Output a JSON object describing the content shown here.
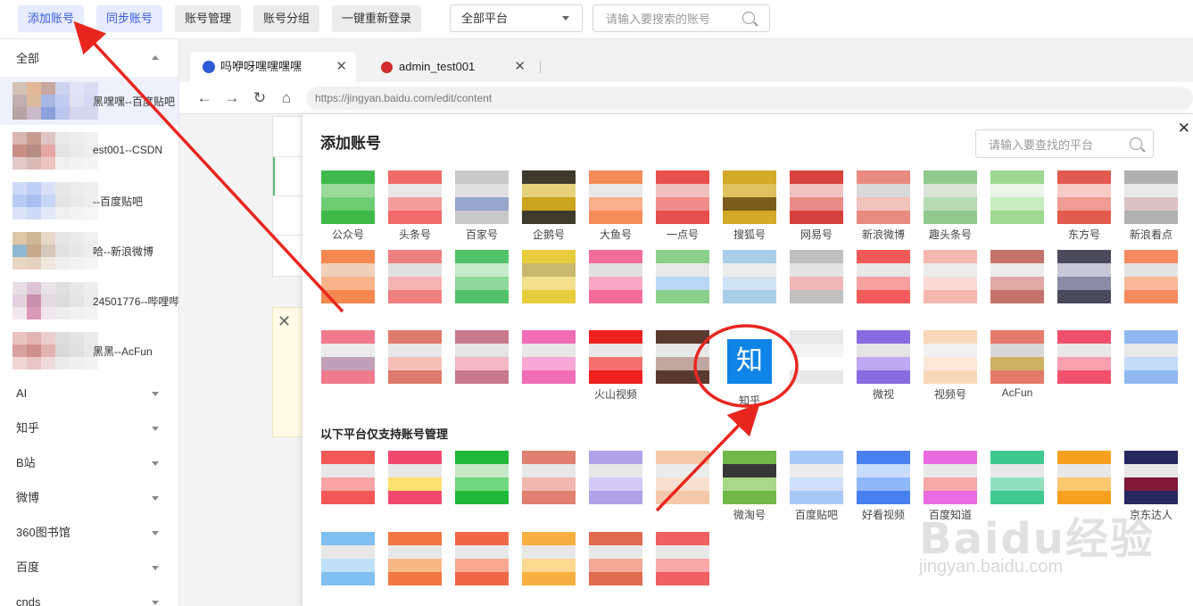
{
  "toolbar": {
    "add_account": "添加账号",
    "sync_account": "同步账号",
    "account_manage": "账号管理",
    "account_group": "账号分组",
    "relogin_all": "一键重新登录",
    "platform_select": "全部平台",
    "search_placeholder": "请输入要搜索的账号"
  },
  "sidebar": {
    "all_group": "全部",
    "accounts": [
      {
        "label": "黑嘿嘿--百度贴吧"
      },
      {
        "label": "est001--CSDN"
      },
      {
        "label": "--百度贴吧"
      },
      {
        "label": "哈--新浪微博"
      },
      {
        "label": "24501776--哔哩哔"
      },
      {
        "label": "黑黑--AcFun"
      }
    ],
    "groups": [
      "AI",
      "知乎",
      "B站",
      "微博",
      "360图书馆",
      "百度",
      "cnds"
    ]
  },
  "browser": {
    "tabs": [
      {
        "title": "吗咿呀嘿嘿嘿嘿"
      },
      {
        "title": "admin_test001"
      }
    ],
    "url": "https://jingyan.baidu.com/edit/content"
  },
  "modal": {
    "title": "添加账号",
    "search_placeholder": "请输入要查找的平台",
    "section_label": "以下平台仅支持账号管理",
    "row1": [
      "公众号",
      "头条号",
      "百家号",
      "企鹅号",
      "大鱼号",
      "一点号",
      "搜狐号",
      "网易号",
      "新浪微博",
      "趣头条号",
      "",
      "东方号",
      "新浪看点"
    ],
    "row3_names": [
      "火山视频",
      "知乎",
      "微视",
      "视频号",
      "AcFun"
    ],
    "zhihu_glyph": "知",
    "row4_names": [
      "微淘号",
      "百度贴吧",
      "好看视频",
      "百度知道",
      "京东达人"
    ]
  },
  "watermark": {
    "brand": "Baidu经验",
    "url": "jingyan.baidu.com"
  }
}
